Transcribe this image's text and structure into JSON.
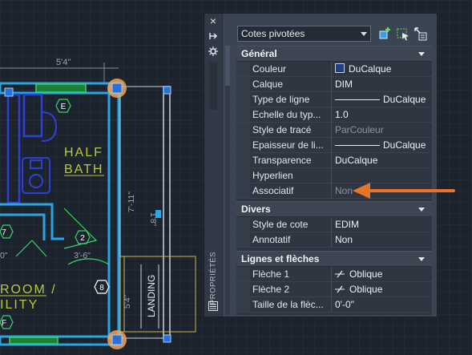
{
  "drawing": {
    "dim_top": "5'4\"",
    "tag_e": "E",
    "label_half": "HALF",
    "label_bath": "BATH",
    "tag_7": "7",
    "tag_2": "2",
    "dim_36": "3'-6\"",
    "dim_0": "0\"",
    "tag_8": "8",
    "label_room": "ROOM /",
    "label_ility": "ILITY",
    "tag_f": "F",
    "landing": "LANDING",
    "dim_711": "7'-11\"",
    "dim_54": "5'4\"",
    "dim_18": "1'8\""
  },
  "palette": {
    "strip_title": "PROPRIÉTÉS",
    "close_icon": "×",
    "selector_value": "Cotes pivotées",
    "sections": [
      {
        "title": "Général",
        "rows": [
          {
            "name": "Couleur",
            "value": "DuCalque",
            "kind": "color",
            "color": "#1f3f86"
          },
          {
            "name": "Calque",
            "value": "DIM",
            "kind": "text"
          },
          {
            "name": "Type de ligne",
            "value": "DuCalque",
            "kind": "linetype"
          },
          {
            "name": "Echelle du typ...",
            "value": "1.0",
            "kind": "text"
          },
          {
            "name": "Style de tracé",
            "value": "ParCouleur",
            "kind": "dim"
          },
          {
            "name": "Epaisseur de li...",
            "value": "DuCalque",
            "kind": "linetype"
          },
          {
            "name": "Transparence",
            "value": "DuCalque",
            "kind": "text"
          },
          {
            "name": "Hyperlien",
            "value": "",
            "kind": "text"
          },
          {
            "name": "Associatif",
            "value": "Non",
            "kind": "dim"
          }
        ]
      },
      {
        "title": "Divers",
        "rows": [
          {
            "name": "Style de cote",
            "value": "EDIM",
            "kind": "text"
          },
          {
            "name": "Annotatif",
            "value": "Non",
            "kind": "text"
          }
        ]
      },
      {
        "title": "Lignes et flèches",
        "rows": [
          {
            "name": "Flèche 1",
            "value": "Oblique",
            "kind": "arrow"
          },
          {
            "name": "Flèche 2",
            "value": "Oblique",
            "kind": "arrow"
          },
          {
            "name": "Taille de la flèc...",
            "value": "0'-0\"",
            "kind": "text"
          }
        ]
      }
    ]
  },
  "colors": {
    "accent_arrow": "#e8742a",
    "wall": "#2aa8e6",
    "grip": "#f0a35a",
    "text_yellow": "#b8c93a"
  }
}
